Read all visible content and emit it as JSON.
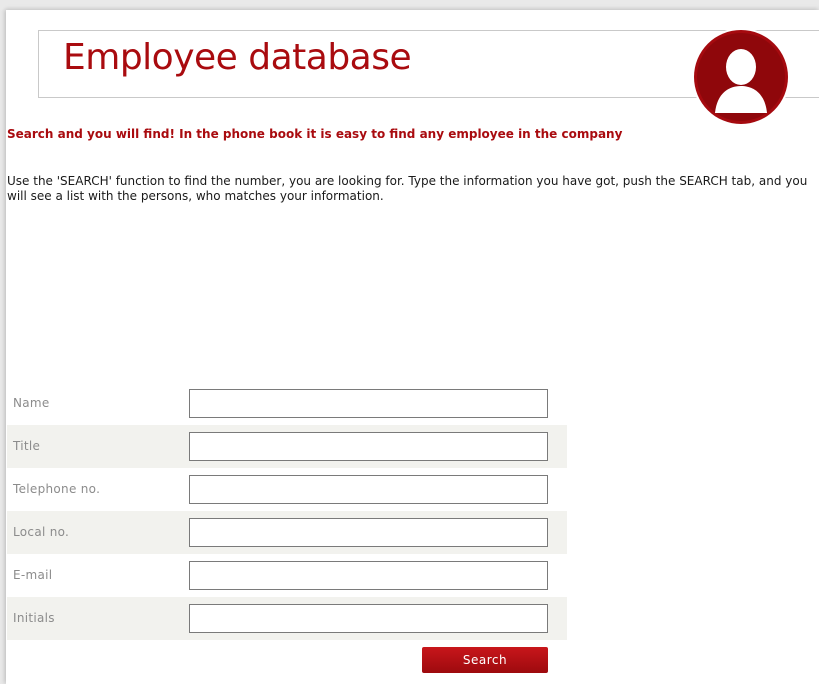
{
  "header": {
    "title": "Employee database"
  },
  "intro": {
    "lead": "Search and you will find! In the phone book it is easy to find any employee in the company",
    "description": "Use the 'SEARCH' function to find the number, you are looking for. Type the information you have got, push the SEARCH tab, and you will see a list with the persons, who matches your information."
  },
  "form": {
    "fields": [
      {
        "label": "Name",
        "value": ""
      },
      {
        "label": "Title",
        "value": ""
      },
      {
        "label": "Telephone no.",
        "value": ""
      },
      {
        "label": "Local no.",
        "value": ""
      },
      {
        "label": "E-mail",
        "value": ""
      },
      {
        "label": "Initials",
        "value": ""
      }
    ],
    "search_label": "Search"
  },
  "colors": {
    "brand_red": "#a90b0f",
    "row_alt": "#f2f2ee",
    "label_gray": "#8c8c8c"
  },
  "icons": {
    "avatar": "user-avatar-icon"
  }
}
